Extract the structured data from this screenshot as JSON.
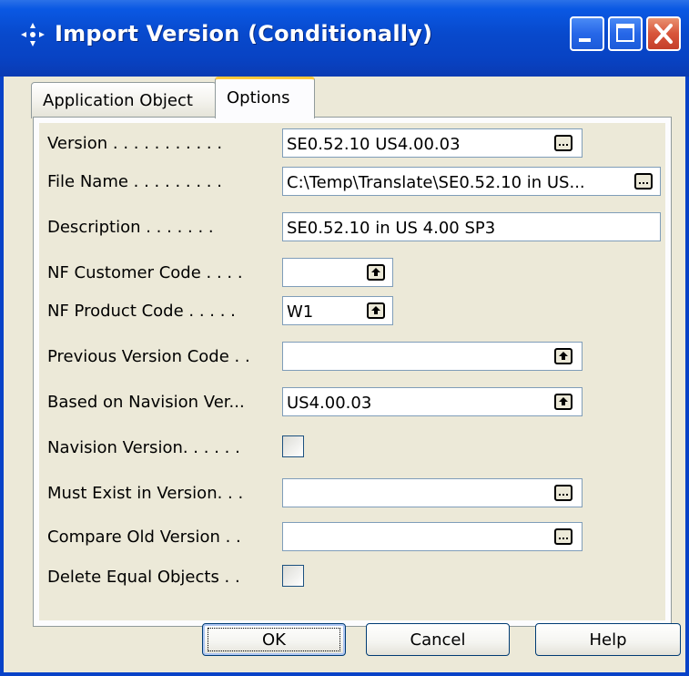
{
  "window": {
    "title": "Import Version (Conditionally)"
  },
  "titlebar_buttons": {
    "minimize": "minimize-icon",
    "maximize": "maximize-icon",
    "close": "close-icon"
  },
  "tabs": [
    {
      "label": "Application Object",
      "active": false
    },
    {
      "label": "Options",
      "active": true
    }
  ],
  "fields": {
    "version": {
      "label": "Version . . . . . . . . . . .",
      "value": "SE0.52.10 US4.00.03",
      "button": "ellipsis"
    },
    "file_name": {
      "label": "File Name . . . . . . . . .",
      "value": "C:\\Temp\\Translate\\SE0.52.10 in US...",
      "button": "ellipsis"
    },
    "description": {
      "label": "Description . . . . . . .",
      "value": "SE0.52.10 in US 4.00 SP3"
    },
    "nf_customer_code": {
      "label": "NF Customer Code . . . .",
      "value": "",
      "button": "lookup"
    },
    "nf_product_code": {
      "label": "NF Product Code . . . . .",
      "value": "W1",
      "button": "lookup"
    },
    "previous_version_code": {
      "label": "Previous Version Code . .",
      "value": "",
      "button": "lookup"
    },
    "based_on_navision_version": {
      "label": "Based on Navision Ver...",
      "value": "US4.00.03",
      "button": "lookup"
    },
    "navision_version": {
      "label": "Navision Version. . . . . .",
      "checked": false
    },
    "must_exist_in_version": {
      "label": "Must Exist in Version. . .",
      "value": "",
      "button": "ellipsis"
    },
    "compare_old_version": {
      "label": "Compare Old Version . .",
      "value": "",
      "button": "ellipsis"
    },
    "delete_equal_objects": {
      "label": "Delete Equal Objects . .",
      "checked": false
    }
  },
  "buttons": {
    "ok": "OK",
    "cancel": "Cancel",
    "help": "Help"
  },
  "colors": {
    "titlebar": "#0a58e3",
    "face": "#ece9d8",
    "active_tab_accent": "#ffc83c",
    "close_button": "#d8553a"
  }
}
